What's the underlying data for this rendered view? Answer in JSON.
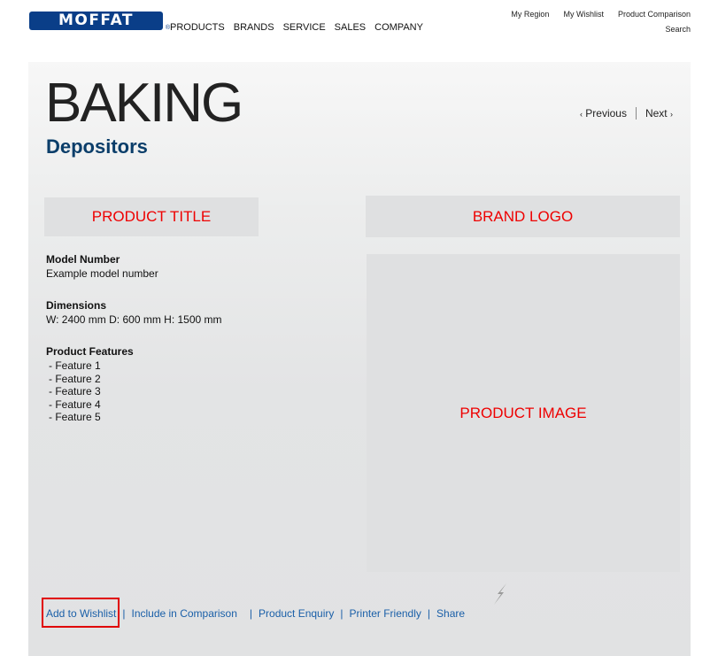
{
  "header": {
    "logo_text": "MOFFAT",
    "logo_mark": "®",
    "nav": [
      "PRODUCTS",
      "BRANDS",
      "SERVICE",
      "SALES",
      "COMPANY"
    ],
    "utility_links": [
      "My Region",
      "My Wishlist",
      "Product Comparison"
    ],
    "search_label": "Search"
  },
  "page": {
    "category": "BAKING",
    "subcategory": "Depositors",
    "prev_label": "Previous",
    "next_label": "Next",
    "prev_chevron": "‹",
    "next_chevron": "›"
  },
  "placeholders": {
    "product_title": "PRODUCT TITLE",
    "brand_logo": "BRAND LOGO",
    "product_image": "PRODUCT IMAGE"
  },
  "specs": {
    "model_label": "Model Number",
    "model_value": "Example model number",
    "dimensions_label": "Dimensions",
    "dimensions_value": "W: 2400 mm D: 600 mm H: 1500 mm",
    "features_label": "Product Features",
    "features": [
      "- Feature 1",
      "- Feature 2",
      "- Feature 3",
      "- Feature 4",
      "- Feature 5"
    ]
  },
  "actions": [
    "Add to Wishlist",
    "Include in Comparison",
    "Product Enquiry",
    "Printer Friendly",
    "Share"
  ],
  "separator": "|",
  "colors": {
    "brand_blue": "#0a3e88",
    "subtitle_blue": "#0b3e6a",
    "link_blue": "#1a5fa8",
    "placeholder_red": "#ee0000",
    "highlight_red": "#e00000"
  },
  "icons": [
    "lightning-bolt-icon"
  ]
}
